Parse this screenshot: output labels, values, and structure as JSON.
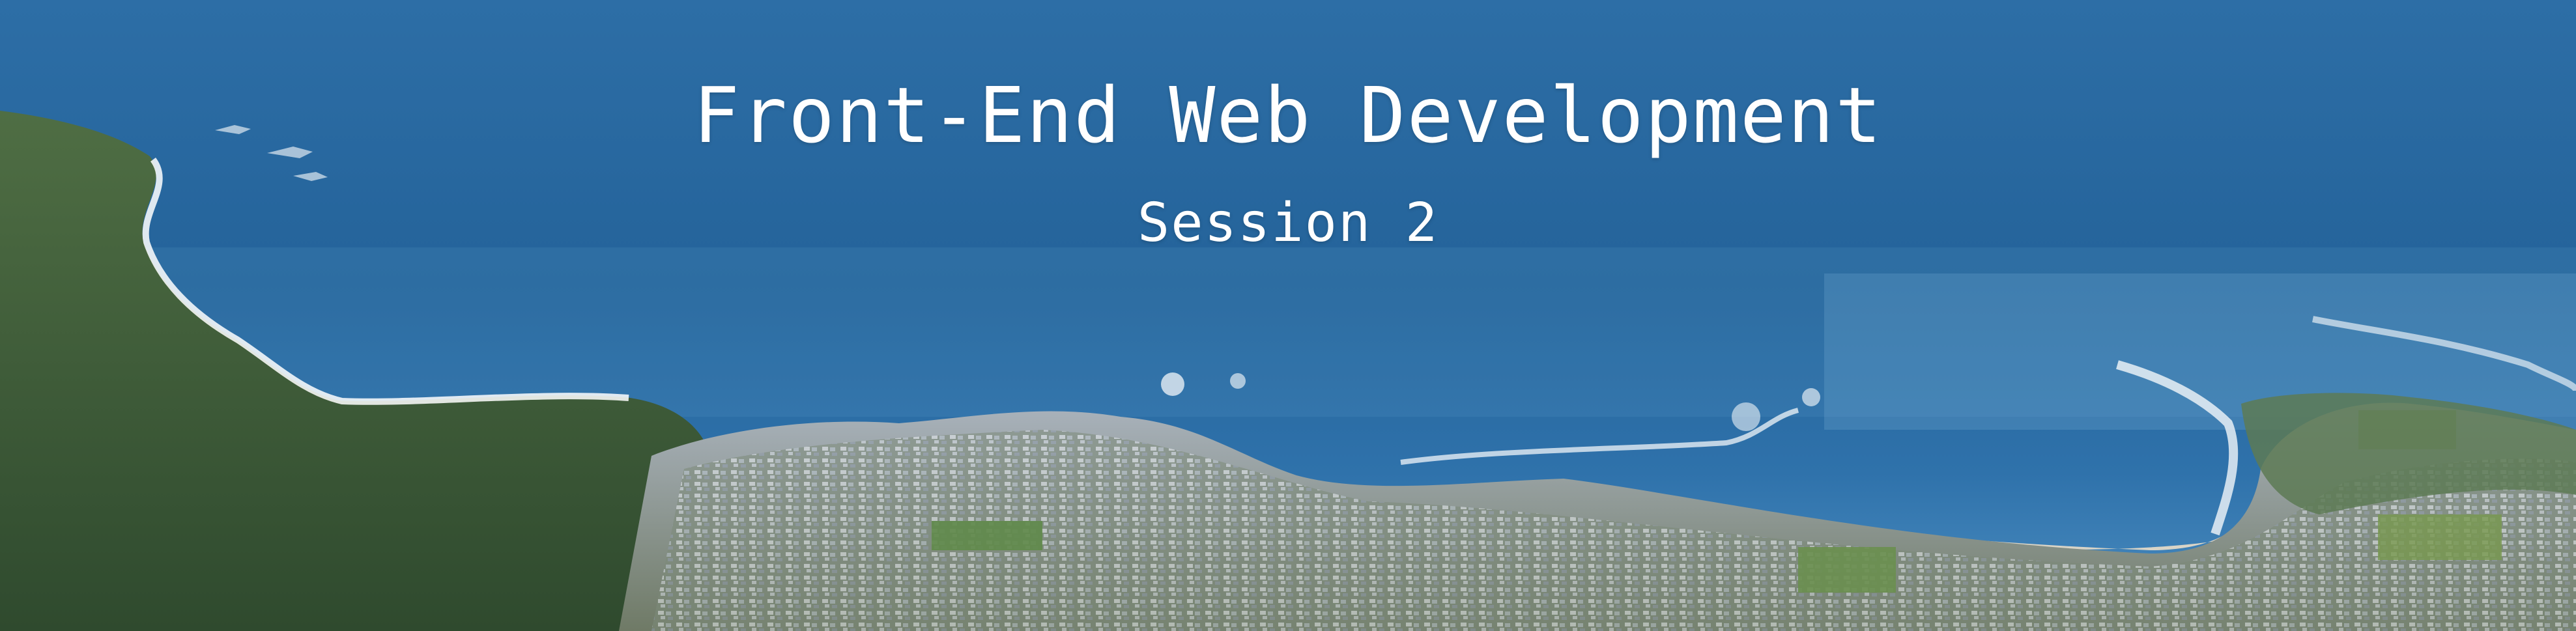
{
  "hero": {
    "title": "Front-End Web Development",
    "subtitle": "Session 2"
  },
  "colors": {
    "ocean_deep": "#24639a",
    "ocean_mid": "#2f72ab",
    "ocean_light": "#4d8fc2",
    "surf": "#ffffff",
    "beach": "#d9d4c7",
    "green": "#4d6b42",
    "green_dark": "#2f4a2e",
    "city": "#9aa5b2"
  }
}
